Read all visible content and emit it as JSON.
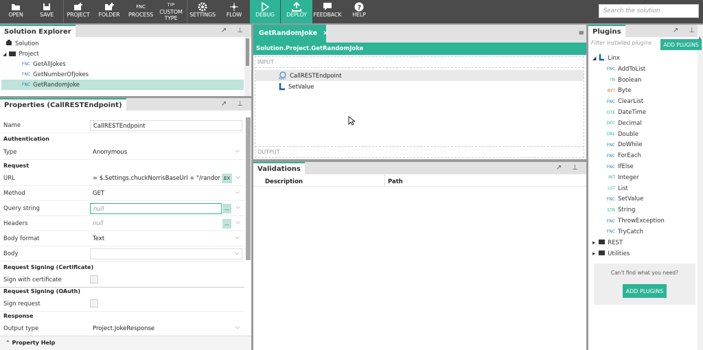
{
  "toolbar": {
    "open": "OPEN",
    "save": "SAVE",
    "project": "PROJECT",
    "folder": "FOLDER",
    "fnc_process_top": "FNC",
    "fnc_process": "PROCESS",
    "custom_type_top": "TYP",
    "custom_type": "CUSTOM TYPE",
    "settings": "SETTINGS",
    "flow": "FLOW",
    "debug": "DEBUG",
    "deploy": "DEPLOY",
    "feedback": "FEEDBACK",
    "help": "HELP",
    "search_placeholder": "Search the solution"
  },
  "solution_explorer": {
    "title": "Solution Explorer",
    "solution": "Solution",
    "project": "Project",
    "items": [
      {
        "tag": "FNC",
        "label": "GetAllJokes"
      },
      {
        "tag": "FNC",
        "label": "GetNumberOfJokes"
      },
      {
        "tag": "FNC",
        "label": "GetRandomJoke"
      }
    ]
  },
  "properties": {
    "title": "Properties (CallRESTEndpoint)",
    "name_label": "Name",
    "name_value": "CallRESTEndpoint",
    "auth_section": "Authentication",
    "type_label": "Type",
    "type_value": "Anonymous",
    "request_section": "Request",
    "url_label": "URL",
    "url_value": "= $.Settings.chuckNorrisBaseUrl + \"/random\"",
    "url_btn": "EX",
    "method_label": "Method",
    "method_value": "GET",
    "query_label": "Query string",
    "query_value": "null",
    "dots": "...",
    "headers_label": "Headers",
    "headers_value": "null",
    "bodyformat_label": "Body format",
    "bodyformat_value": "Text",
    "body_label": "Body",
    "cert_section": "Request Signing (Certificate)",
    "cert_label": "Sign with certificate",
    "oauth_section": "Request Signing (OAuth)",
    "sign_label": "Sign request",
    "response_section": "Response",
    "output_label": "Output type",
    "output_value": "Project.JokeResponse",
    "help": "Property Help"
  },
  "editor": {
    "tab": "GetRandomJoke",
    "close": "×",
    "path": "Solution.Project.GetRandomJoke",
    "input": "INPUT",
    "output": "OUTPUT",
    "steps": [
      {
        "label": "CallRESTEndpoint",
        "icon": "rest-icon"
      },
      {
        "label": "SetValue",
        "icon": "linx-icon"
      }
    ]
  },
  "validations": {
    "title": "Validations",
    "col_description": "Description",
    "col_path": "Path"
  },
  "plugins": {
    "title": "Plugins",
    "filter_placeholder": "Filter installed plugins",
    "add_btn": "ADD PLUGINS",
    "root": "Linx",
    "items": [
      {
        "tag": "FNC",
        "label": "AddToList"
      },
      {
        "tag": "YN",
        "label": "Boolean"
      },
      {
        "tag": "BYT",
        "label": "Byte"
      },
      {
        "tag": "FNC",
        "label": "ClearList"
      },
      {
        "tag": "DTE",
        "label": "DateTime"
      },
      {
        "tag": "DEC",
        "label": "Decimal"
      },
      {
        "tag": "DBL",
        "label": "Double"
      },
      {
        "tag": "FNC",
        "label": "DoWhile"
      },
      {
        "tag": "FNC",
        "label": "ForEach"
      },
      {
        "tag": "FNC",
        "label": "IfElse"
      },
      {
        "tag": "INT",
        "label": "Integer"
      },
      {
        "tag": "LST",
        "label": "List"
      },
      {
        "tag": "FNC",
        "label": "SetValue"
      },
      {
        "tag": "STR",
        "label": "String"
      },
      {
        "tag": "FNC",
        "label": "ThrowException"
      },
      {
        "tag": "FNC",
        "label": "TryCatch"
      }
    ],
    "rest": "REST",
    "utilities": "Utilities",
    "cant_find": "Can't find what you need?",
    "add_btn2": "ADD PLUGINS"
  },
  "colors": {
    "accent": "#2db396",
    "toolbar": "#4b4b4b"
  }
}
